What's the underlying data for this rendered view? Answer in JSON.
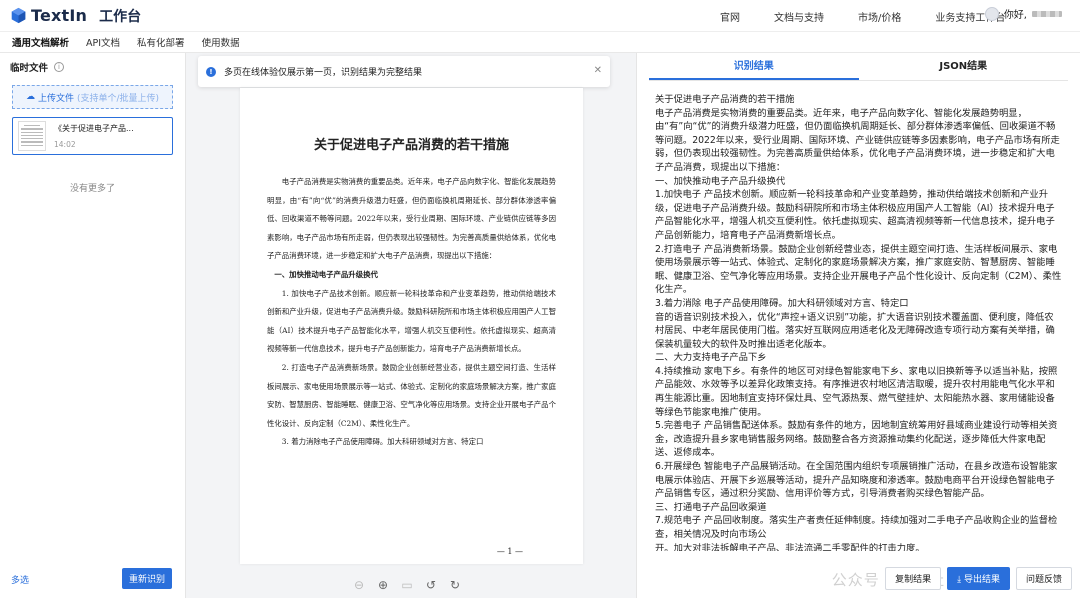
{
  "app": {
    "logo_text": "TextIn",
    "section_title": "工作台"
  },
  "topnav": [
    "官网",
    "文档与支持",
    "市场/价格",
    "业务支持工作台"
  ],
  "user": {
    "greeting": "你好,"
  },
  "subnav": [
    "通用文档解析",
    "API文档",
    "私有化部署",
    "使用数据"
  ],
  "sidebar": {
    "title": "临时文件",
    "upload_label": "上传文件",
    "upload_hint": "(支持单个/批量上传)",
    "file": {
      "name": "《关于促进电子产品...",
      "time": "14:02"
    },
    "no_more": "没有更多了",
    "multi_select": "多选",
    "rerun_button": "重新识别"
  },
  "notice": {
    "text": "多页在线体验仅展示第一页，识别结果为完整结果"
  },
  "document": {
    "title": "关于促进电子产品消费的若干措施",
    "paragraphs": [
      {
        "type": "p",
        "text": "电子产品消费是实物消费的重要品类。近年来，电子产品向数字化、智能化发展趋势明显，由“有”向“优”的消费升级潜力旺盛，但仍面临换机周期延长、部分群体渗透率偏低、回收渠道不畅等问题。2022年以来，受行业周期、国际环境、产业链供应链等多因素影响，电子产品市场有所走弱，但仍表现出较强韧性。为完善高质量供给体系，优化电子产品消费环境，进一步稳定和扩大电子产品消费，现提出以下措施："
      },
      {
        "type": "h",
        "text": "一、加快推动电子产品升级换代"
      },
      {
        "type": "p",
        "text": "1. 加快电子产品技术创新。顺应新一轮科技革命和产业变革趋势，推动供给端技术创新和产业升级，促进电子产品消费升级。鼓励科研院所和市场主体积极应用国产人工智能（AI）技术提升电子产品智能化水平，增强人机交互便利性。依托虚拟现实、超高清视频等新一代信息技术，提升电子产品创新能力，培育电子产品消费新增长点。"
      },
      {
        "type": "p",
        "text": "2. 打造电子产品消费新场景。鼓励企业创新经营业态，提供主题空间打造、生活样板间展示、家电使用场景展示等一站式、体验式、定制化的家庭场景解决方案，推广家庭安防、智慧厨房、智能睡眠、健康卫浴、空气净化等应用场景。支持企业开展电子产品个性化设计、反向定制（C2M）、柔性化生产。"
      },
      {
        "type": "p",
        "text": "3. 着力消除电子产品使用障碍。加大科研领域对方言、特定口"
      }
    ],
    "page_number": "— 1 —"
  },
  "result_tabs": [
    "识别结果",
    "JSON结果"
  ],
  "result_lines": [
    "关于促进电子产品消费的若干措施",
    "电子产品消费是实物消费的重要品类。近年来，电子产品向数字化、智能化发展趋势明显，由“有”向“优”的消费升级潜力旺盛，但仍面临换机周期延长、部分群体渗透率偏低、回收渠道不畅等问题。2022年以来，受行业周期、国际环境、产业链供应链等多因素影响，电子产品市场有所走弱，但仍表现出较强韧性。为完善高质量供给体系，优化电子产品消费环境，进一步稳定和扩大电子产品消费，现提出以下措施：",
    "一、加快推动电子产品升级换代",
    "1.加快电子 产品技术创新。顺应新一轮科技革命和产业变革趋势，推动供给端技术创新和产业升级，促进电子产品消费升级。鼓励科研院所和市场主体积极应用国产人工智能（AI）技术提升电子产品智能化水平，增强人机交互便利性。依托虚拟现实、超高清视频等新一代信息技术，提升电子产品创新能力，培育电子产品消费新增长点。",
    "2.打造电子 产品消费新场景。鼓励企业创新经营业态，提供主题空间打造、生活样板间展示、家电使用场景展示等一站式、体验式、定制化的家庭场景解决方案，推广家庭安防、智慧厨房、智能睡眠、健康卫浴、空气净化等应用场景。支持企业开展电子产品个性化设计、反向定制（C2M）、柔性化生产。",
    "3.着力消除 电子产品使用障碍。加大科研领域对方言、特定口",
    "音的语音识别技术投入，优化“声控+语义识别”功能，扩大语音识别技术覆盖面、便利度，降低农村居民、中老年居民使用门槛。落实好互联网应用适老化及无障碍改造专项行动方案有关举措，确保装机量较大的软件及时推出适老化版本。",
    "二、大力支持电子产品下乡",
    "4.持续推动 家电下乡。有条件的地区可对绿色智能家电下乡、家电以旧换新等予以适当补贴，按照产品能效、水效等予以差异化政策支持。有序推进农村地区清洁取暖，提升农村用能电气化水平和再生能源比重。因地制宜支持环保灶具、空气源热泵、燃气壁挂炉、太阳能热水器、家用储能设备等绿色节能家电推广使用。",
    "5.完善电子 产品销售配送体系。鼓励有条件的地方，因地制宜统筹用好县域商业建设行动等相关资金，改造提升县乡家电销售服务网络。鼓励整合各方资源推动集约化配送，逐步降低大件家电配送、返修成本。",
    "6.开展绿色 智能电子产品展销活动。在全国范围内组织专项展销推广活动，在县乡改造布设智能家电展示体验店、开展下乡巡展等活动，提升产品知晓度和渗透率。鼓励电商平台开设绿色智能电子产品销售专区，通过积分奖励、信用评价等方式，引导消费者购买绿色智能产品。",
    "三、打通电子产品回收渠道",
    "7.规范电子 产品回收制度。落实生产者责任延伸制度。持续加强对二手电子产品收购企业的监督检查，相关情况及时向市场公",
    "开。加大对非法拆解电子产品、非法流通二手零配件的打击力度。"
  ],
  "result_actions": [
    "复制结果",
    "导出结果",
    "问题反馈"
  ],
  "watermark": "公众号 · 合研社",
  "colors": {
    "accent": "#2a6fdb",
    "canvas": "#f3f4f6"
  }
}
